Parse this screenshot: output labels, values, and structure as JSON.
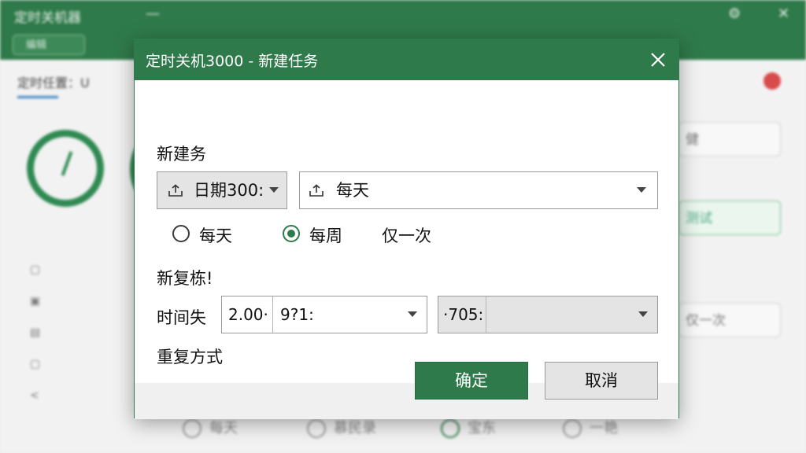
{
  "background": {
    "title": "定时关机器",
    "tab": "编辑",
    "label": "定时任置：U",
    "right_field_1": "健",
    "right_field_2": "测试",
    "right_field_3": "仅一次",
    "bottom_options": [
      "每天",
      "慕民录",
      "宝东",
      "一艳"
    ]
  },
  "dialog": {
    "title": "定时关机3000 - 新建任务",
    "section_new_task": "新建务",
    "date_combo": {
      "value": "日期300:"
    },
    "freq_combo": {
      "value": "每天"
    },
    "radios": [
      {
        "label": "每天",
        "checked": false
      },
      {
        "label": "每周",
        "checked": true
      },
      {
        "label": "仅一次",
        "checked": false
      }
    ],
    "section_repeat": "新复栋!",
    "time_label": "时间失",
    "time_field_1": "2.00·",
    "time_field_2": "9?1:",
    "time_field_3": "·705:",
    "repeat_mode_label": "重复方式",
    "ok_label": "确定",
    "cancel_label": "取消"
  },
  "colors": {
    "accent": "#2f7a4a",
    "danger": "#d94a4a"
  }
}
